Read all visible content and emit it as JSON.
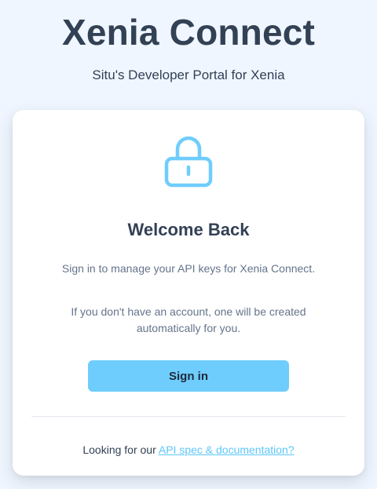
{
  "header": {
    "title": "Xenia Connect",
    "subtitle": "Situ's Developer Portal for Xenia"
  },
  "card": {
    "icon": "lock-icon",
    "heading": "Welcome Back",
    "description": "Sign in to manage your API keys for Xenia Connect.",
    "note": "If you don't have an account, one will be created automatically for you.",
    "signin_label": "Sign in",
    "footer_prefix": "Looking for our ",
    "footer_link": "API spec & documentation?"
  },
  "colors": {
    "background": "#eff6ff",
    "accent": "#6fcdfd",
    "link": "#5bc6fb",
    "heading_text": "#334155",
    "muted_text": "#64748b"
  }
}
